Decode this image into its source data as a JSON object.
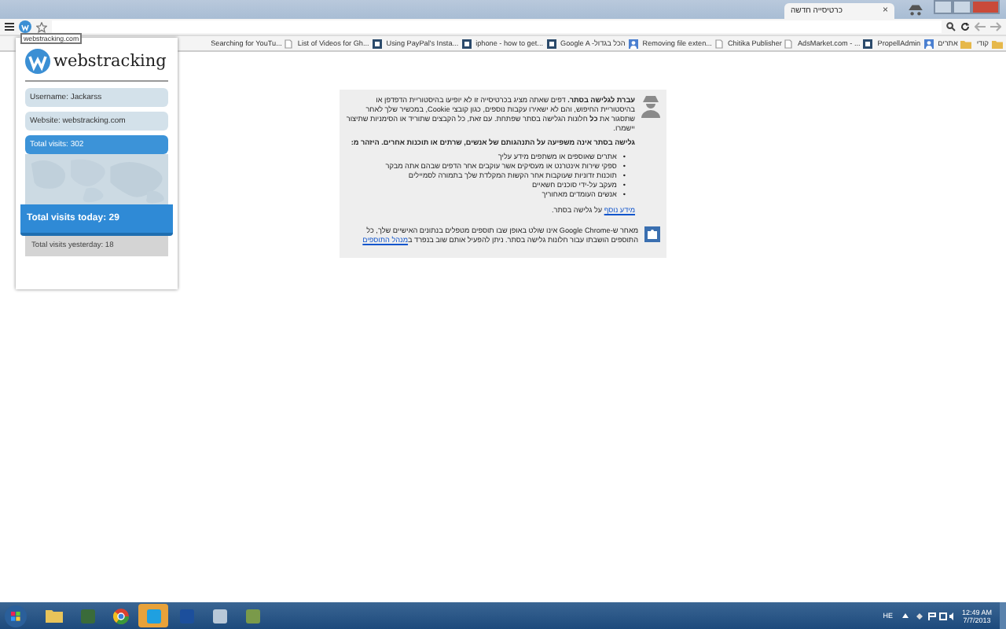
{
  "browser": {
    "tab": {
      "title": "כרטיסייה חדשה",
      "close": "×"
    },
    "tooltip": "webstracking.com",
    "bookmarks": [
      {
        "label": "קודי",
        "kind": "folder"
      },
      {
        "label": "אתרים",
        "kind": "folder"
      },
      {
        "label": "PropellAdmin",
        "kind": "user"
      },
      {
        "label": "AdsMarket.com - ...",
        "kind": "app"
      },
      {
        "label": "Chitika Publisher",
        "kind": "page"
      },
      {
        "label": "Removing file exten...",
        "kind": "page"
      },
      {
        "label": "Google A -הכל בגדול",
        "kind": "user"
      },
      {
        "label": "iphone - how to get...",
        "kind": "app"
      },
      {
        "label": "Using PayPal's Insta...",
        "kind": "app"
      },
      {
        "label": "List of Videos for Gh...",
        "kind": "app"
      },
      {
        "label": "Searching for YouTu...",
        "kind": "page"
      }
    ]
  },
  "popup": {
    "brand": "webstracking",
    "username": "Username: Jackarss",
    "website": "Website: webstracking.com",
    "total": "Total visits: 302",
    "today": "Total visits today: 29",
    "yesterday": "Total visits yesterday: 18"
  },
  "incognito": {
    "lead": "**עברת לגלישה בסתר.** דפים שאתה מציג בכרטיסייה זו לא יופיעו בהיסטוריית הדפדפן או בהיסטוריית החיפוש, והם לא ישאירו עקבות נוספים, כגון קובצי Cookie, במכשיר שלך לאחר שתסגור את **כל** חלונות הגלישה בסתר שפתחת. עם זאת, כל הקבצים שתוריד או הסימניות שתיצור יישמרו.",
    "warning": "גלישה בסתר אינה משפיעה על התנהגותם של אנשים, שרתים או תוכנות אחרים. היזהר מ:",
    "bullet": "•",
    "items": [
      "אתרים שאוספים או משתפים מידע עליך",
      "ספקי שירות אינטרנט או מעסיקים אשר עוקבים אחר הדפים שבהם אתה מבקר",
      "תוכנות זדוניות שעוקבות אחר הקשות המקלדת שלך בתמורה לסמיילים",
      "מעקב על-ידי סוכנים חשאיים",
      "אנשים העומדים מאחוריך"
    ],
    "more_link": "מידע נוסף",
    "more_text": "על גלישה בסתר.",
    "ext_text": "מאחר ש-Google Chrome אינו שולט באופן שבו תוספים מטפלים בנתונים האישיים שלך, כל התוספים הושבתו עבור חלונות גלישה בסתר. ניתן להפעיל אותם שוב בנפרד ב",
    "ext_link": "מנהל התוספים"
  },
  "taskbar": {
    "apps": [
      {
        "kind": "folder",
        "selected": false
      },
      {
        "kind": "monitor",
        "selected": false
      },
      {
        "kind": "chrome",
        "selected": false
      },
      {
        "kind": "skype",
        "selected": true
      },
      {
        "kind": "photoshop",
        "selected": false
      },
      {
        "kind": "app",
        "selected": false
      },
      {
        "kind": "tool",
        "selected": false
      }
    ],
    "language": "HE",
    "time": "12:49 AM",
    "date": "7/7/2013"
  }
}
